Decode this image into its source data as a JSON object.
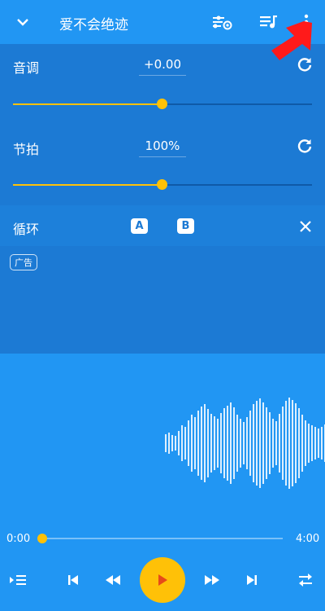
{
  "header": {
    "title": "爱不会绝迹",
    "icons": [
      "chevron-down-icon",
      "equalizer-settings-icon",
      "playlist-icon",
      "more-vert-icon"
    ]
  },
  "pitch": {
    "label": "音调",
    "value": "+0.00",
    "level": 0.5
  },
  "tempo": {
    "label": "节拍",
    "value": "100%",
    "level": 0.5
  },
  "loop": {
    "label": "循环",
    "a": "A",
    "b": "B"
  },
  "ad": {
    "tag": "广告"
  },
  "player": {
    "current_time": "0:00",
    "total_time": "4:00",
    "progress": 0.0,
    "controls": [
      "queue-add-icon",
      "skip-previous-icon",
      "rewind-icon",
      "play-icon",
      "fast-forward-icon",
      "skip-next-icon",
      "repeat-icon"
    ]
  },
  "colors": {
    "primary": "#2196f3",
    "panel": "#1c7ad4",
    "accent": "#ffc107",
    "annotation_arrow": "#ff1a1a"
  }
}
